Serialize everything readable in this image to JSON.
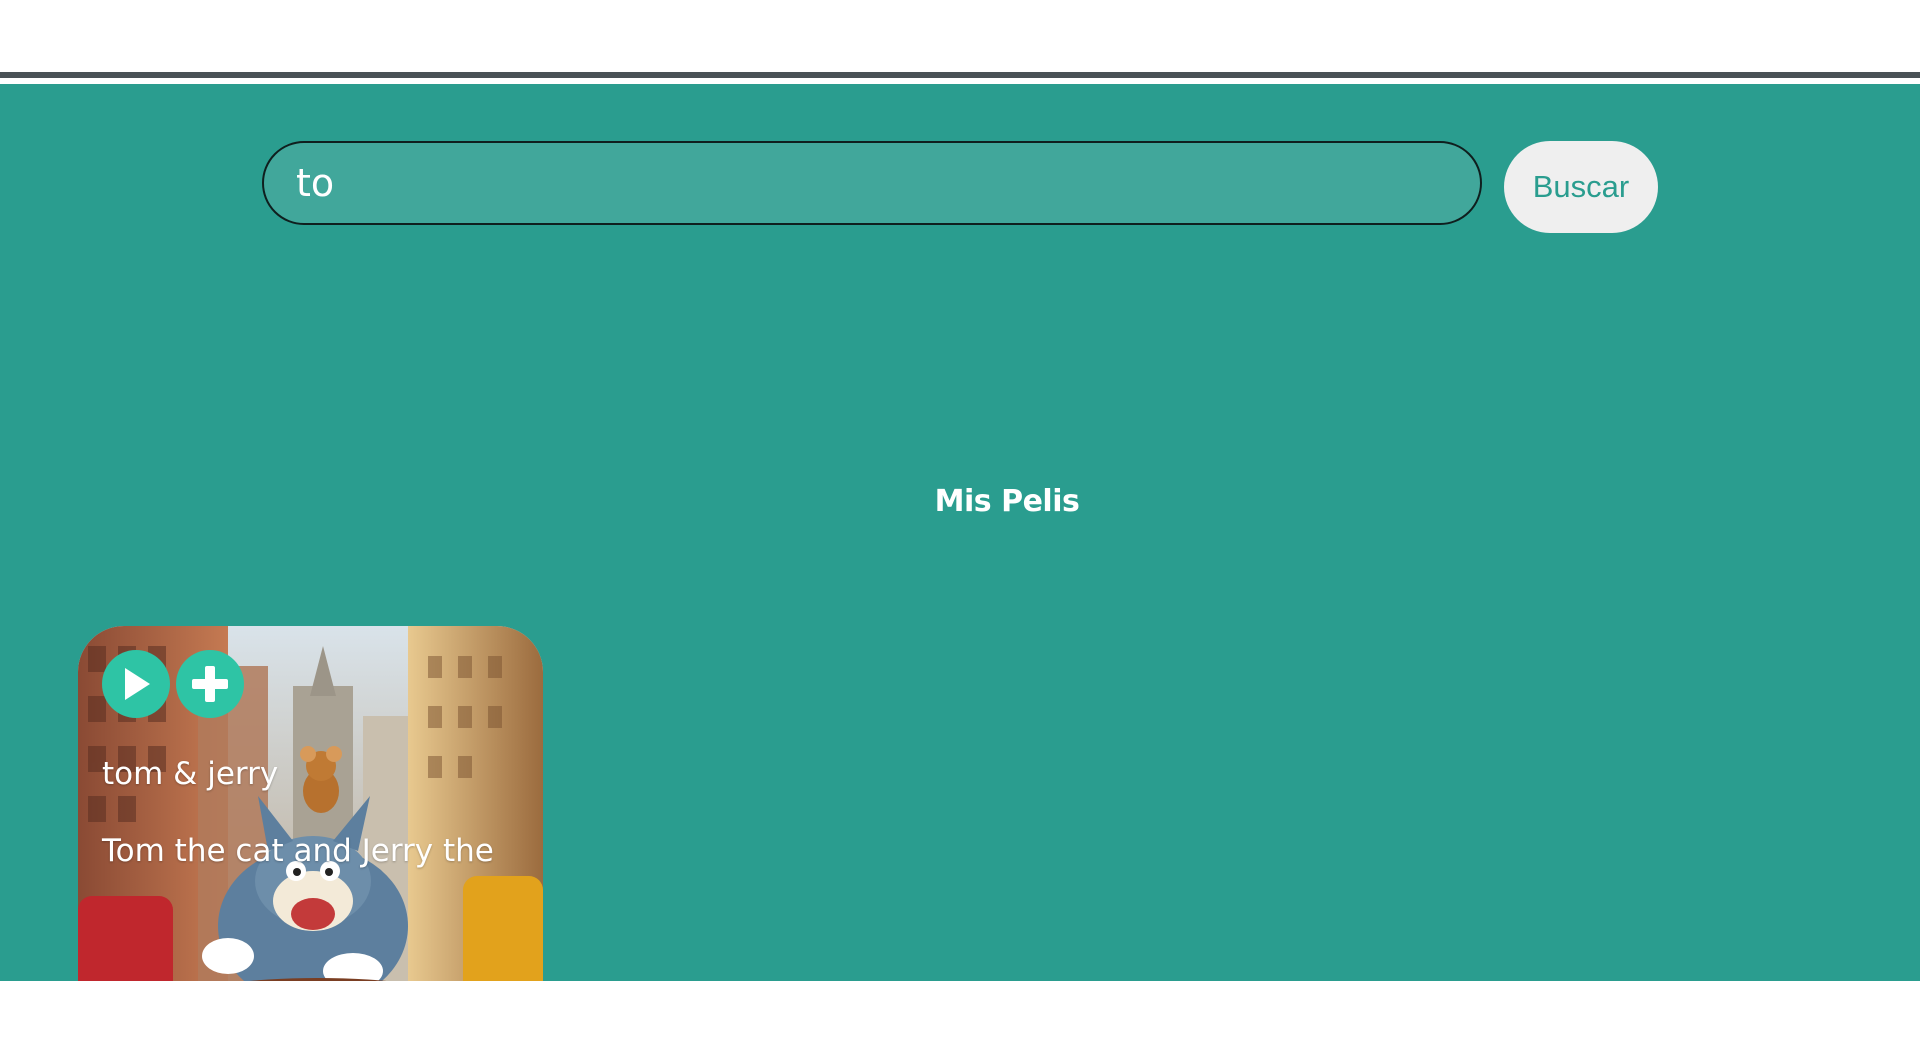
{
  "search": {
    "value": "to",
    "button_label": "Buscar"
  },
  "section": {
    "title": "Mis Pelis"
  },
  "movies": [
    {
      "title": "tom & jerry",
      "description": "Tom the cat and Jerry the"
    }
  ],
  "icons": {
    "play": "play-icon",
    "add": "plus-icon"
  },
  "colors": {
    "background": "#2a9d8f",
    "input_background": "#41a79b",
    "button_background": "#efefef",
    "button_text": "#2a9d8f",
    "action_button": "#2ec4a5",
    "top_border": "#4a5256"
  }
}
